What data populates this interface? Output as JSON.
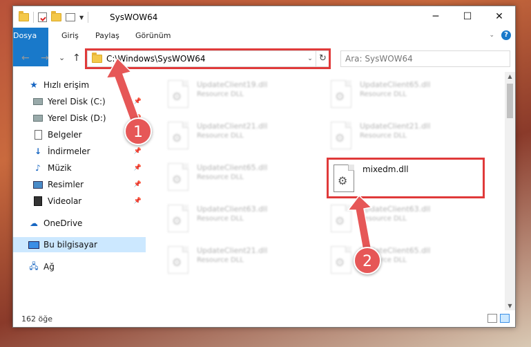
{
  "window": {
    "title": "SysWOW64",
    "minimize_glyph": "─",
    "maximize_glyph": "☐",
    "close_glyph": "✕"
  },
  "ribbon": {
    "tabs": [
      "Dosya",
      "Giriş",
      "Paylaş",
      "Görünüm"
    ],
    "help": "?"
  },
  "nav": {
    "back": "←",
    "forward": "→",
    "recent": "⌄",
    "up": "↑",
    "refresh": "↻"
  },
  "address": {
    "path": "C:\\Windows\\SysWOW64"
  },
  "search": {
    "placeholder": "Ara: SysWOW64"
  },
  "sidebar": {
    "items": [
      {
        "label": "Hızlı erişim",
        "icon": "star-icon"
      },
      {
        "label": "Yerel Disk (C:)",
        "icon": "drive-icon"
      },
      {
        "label": "Yerel Disk (D:)",
        "icon": "drive-icon"
      },
      {
        "label": "Belgeler",
        "icon": "documents-icon"
      },
      {
        "label": "İndirmeler",
        "icon": "download-icon"
      },
      {
        "label": "Müzik",
        "icon": "music-icon"
      },
      {
        "label": "Resimler",
        "icon": "pictures-icon"
      },
      {
        "label": "Videolar",
        "icon": "videos-icon"
      },
      {
        "label": "OneDrive",
        "icon": "cloud-icon"
      },
      {
        "label": "Bu bilgisayar",
        "icon": "computer-icon"
      },
      {
        "label": "Ağ",
        "icon": "network-icon"
      }
    ]
  },
  "files": [
    {
      "name": "UpdateClient19.dll",
      "type": "Resource DLL"
    },
    {
      "name": "UpdateClient65.dll",
      "type": "Resource DLL"
    },
    {
      "name": "UpdateClient21.dll",
      "type": "Resource DLL"
    },
    {
      "name": "UpdateClient21.dll",
      "type": "Resource DLL"
    },
    {
      "name": "UpdateClient65.dll",
      "type": "Resource DLL"
    },
    {
      "name": "mixedm.dll",
      "type": ""
    },
    {
      "name": "UpdateClient63.dll",
      "type": "Resource DLL"
    },
    {
      "name": "UpdateClient63.dll",
      "type": "Resource DLL"
    },
    {
      "name": "UpdateClient21.dll",
      "type": "Resource DLL"
    },
    {
      "name": "UpdateClient65.dll",
      "type": "Resource DLL"
    }
  ],
  "status": {
    "count": "162 öğe"
  },
  "annotations": {
    "step1": "1",
    "step2": "2",
    "highlight_color": "#e03a3a"
  }
}
